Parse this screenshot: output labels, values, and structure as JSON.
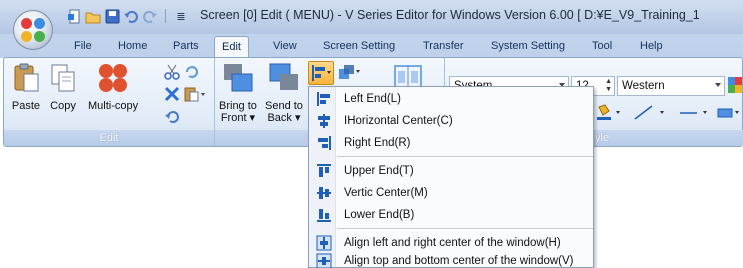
{
  "window": {
    "title": "Screen [0] Edit (      MENU) - V Series Editor for Windows Version 6.00 [ D:¥E_V9_Training_1"
  },
  "quick_access": {
    "items": [
      "new-icon",
      "open-folder-icon",
      "save-icon",
      "undo-icon",
      "redo-icon",
      "customize-icon"
    ],
    "customize_glyph": "≣"
  },
  "tabs": [
    {
      "label": "File"
    },
    {
      "label": "Home"
    },
    {
      "label": "Parts"
    },
    {
      "label": "Edit",
      "active": true
    },
    {
      "label": "View"
    },
    {
      "label": "Screen Setting"
    },
    {
      "label": "Transfer"
    },
    {
      "label": "System Setting"
    },
    {
      "label": "Tool"
    },
    {
      "label": "Help"
    }
  ],
  "ribbon": {
    "edit_group": {
      "label": "Edit",
      "paste": "Paste",
      "copy": "Copy",
      "multi_copy": "Multi-copy"
    },
    "place_group": {
      "label": "Place",
      "bring_to_front": [
        "Bring to",
        "Front ▾"
      ],
      "send_to_back": [
        "Send to",
        "Back ▾"
      ]
    },
    "style_group": {
      "label": "yle",
      "font_name": "System",
      "font_size": "12",
      "charset": "Western"
    }
  },
  "align_menu": {
    "items": [
      {
        "label": "Left End(L)",
        "icon": "align-left-icon"
      },
      {
        "label": "IHorizontal Center(C)",
        "icon": "align-horizontal-center-icon"
      },
      {
        "label": "Right End(R)",
        "icon": "align-right-icon"
      },
      {
        "label": "Upper End(T)",
        "icon": "align-top-icon"
      },
      {
        "label": "Vertic Center(M)",
        "icon": "align-vertical-center-icon"
      },
      {
        "label": "Lower End(B)",
        "icon": "align-bottom-icon"
      },
      {
        "label": "Align left and right center of the window(H)",
        "icon": "window-center-horizontal-icon"
      },
      {
        "label": "Align top and bottom center of the window(V)",
        "icon": "window-center-vertical-icon"
      }
    ]
  },
  "colors": {
    "accent_blue": "#1f5fb8",
    "ribbon_border": "#8da7cb",
    "tab_text": "#15315a"
  }
}
